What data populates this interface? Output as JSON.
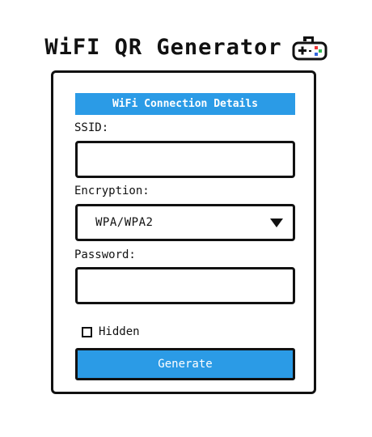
{
  "header": {
    "title": "WiFI QR Generator",
    "icon": "game-controller-icon"
  },
  "form": {
    "section_title": "WiFi Connection Details",
    "ssid_label": "SSID:",
    "ssid_value": "",
    "encryption_label": "Encryption:",
    "encryption_value": "WPA/WPA2",
    "password_label": "Password:",
    "password_value": "",
    "hidden_label": "Hidden",
    "hidden_checked": false,
    "generate_label": "Generate"
  },
  "colors": {
    "accent": "#2b9be6",
    "text": "#111111",
    "background": "#ffffff"
  }
}
